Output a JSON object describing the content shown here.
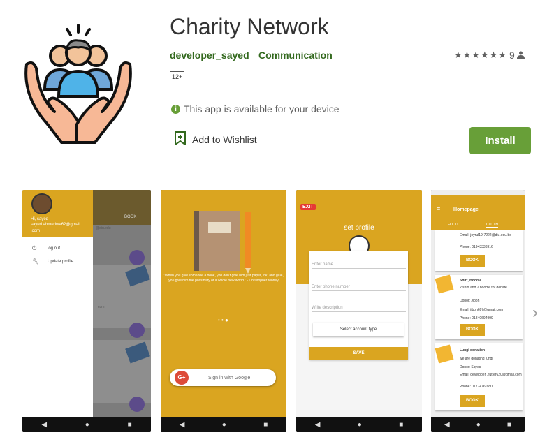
{
  "app": {
    "title": "Charity Network",
    "developer": "developer_sayed",
    "category": "Communication",
    "rating_count": "9",
    "content_rating": "12+",
    "availability": "This app is available for your device",
    "wishlist_label": "Add to Wishlist",
    "install_label": "Install"
  },
  "colors": {
    "accent_green": "#689f38",
    "link_green": "#33691e",
    "app_yellow": "#daa520"
  },
  "shot1": {
    "greeting": "Hi, sayed",
    "email": "sayed.ahmedwe62@gmail .com",
    "menu": [
      "log out",
      "Update profile"
    ],
    "tab_book": "BOOK",
    "bg_text_1": "@diu.edu",
    "bg_text_2": "com"
  },
  "shot2": {
    "quote": "\"When you give someone a book, you don't give him just paper, ink, and glue, you give him the possibility of a whole new world.\" - Christopher Morley",
    "signin": "Sign in with Google"
  },
  "shot3": {
    "exit": "EXIT",
    "title": "set profile",
    "fields": [
      "Enter name",
      "Enter phone number",
      "Write description"
    ],
    "select": "Select account type",
    "save": "SAVE"
  },
  "shot4": {
    "header": "Homepage",
    "tabs": [
      "FOOD",
      "CLOTH"
    ],
    "card1": {
      "email": "Email: joyrul19-7222@diu.edu.bd",
      "phone": "Phone: 01943333916",
      "btn": "BOOK"
    },
    "card2": {
      "title": "Shirt, Hoodie",
      "desc": "2 shirt and 2 hoodie for donate",
      "donor": "Donor: Jibon",
      "email": "Email: jibon697@gmail.com",
      "phone": "Phone: 01840694999",
      "btn": "BOOK"
    },
    "card3": {
      "title": "Lungi donation",
      "desc": "we are donating lungi",
      "donor": "Donor: Sayes",
      "email": "Email: developer .flutter620@gmail.com",
      "phone": "Phone: 01774760591",
      "btn": "BOOK"
    }
  }
}
